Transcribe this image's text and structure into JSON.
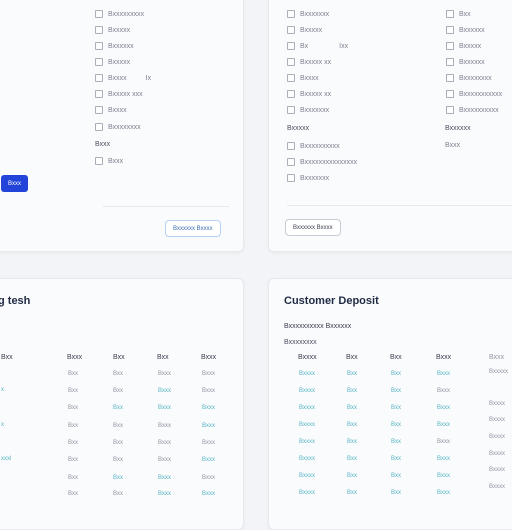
{
  "top_left": {
    "options": [
      "Bxxxxxxxxx",
      "Bxxxxx",
      "Bxxxxxx",
      "Bxxxxx",
      "Bxxxx",
      "Bxxxxx xxx",
      "Bxxxx",
      "Bxxxxxxxx"
    ],
    "option_suffixes": {
      "4": "Ix"
    },
    "section": "Bxxx",
    "section_options": [
      "Bxxx"
    ],
    "primary_button": "Bxxx",
    "outline_button": "Bxxxxxx Bxxxx"
  },
  "top_right": {
    "col1_options": [
      "Bxxxxxxx",
      "Bxxxxx",
      "Bx",
      "Bxxxxx xx",
      "Bxxxx",
      "Bxxxxx xx",
      "Bxxxxxxx"
    ],
    "col1_suffixes": {
      "2": "Ixx"
    },
    "col2_options": [
      "Bxx",
      "Bxxxxxx",
      "Bxxxxx",
      "Bxxxxxx",
      "Bxxxxxxxx",
      "Bxxxxxxxxxxx",
      "Bxxxxxxxxxx"
    ],
    "col1_section": "Bxxxxx",
    "col2_section": "Bxxxxxx",
    "col1_section_options": [
      "Bxxxxxxxxxx",
      "Bxxxxxxxxxxxxxxx",
      "Bxxxxxxx"
    ],
    "col2_section_value": "Bxxx",
    "outline_button": "Bxxxxxx Bxxxx"
  },
  "bottom_left": {
    "title": "g tesh",
    "headers": [
      "Bxx",
      "Bxxx",
      "Bxx",
      "Bxx",
      "Bxxx"
    ],
    "row_labels": [
      "",
      "x",
      "",
      "x",
      "",
      "xxxl",
      "",
      ""
    ],
    "rows": [
      [
        "Bxx",
        "Bxx",
        "Bxxx",
        "Bxxx"
      ],
      [
        "Bxx",
        "Bxx",
        "Bxxx",
        "Bxxx"
      ],
      [
        "Bxx",
        "Bxx",
        "Bxxx",
        "Bxxx"
      ],
      [
        "Bxx",
        "Bxx",
        "Bxxx",
        "Bxxx"
      ],
      [
        "Bxx",
        "Bxx",
        "Bxxx",
        "Bxxx"
      ],
      [
        "Bxx",
        "Bxx",
        "Bxxx",
        "Bxxx"
      ],
      [
        "Bxx",
        "Bxx",
        "Bxxx",
        "Bxxx"
      ],
      [
        "Bxx",
        "Bxx",
        "Bxxx",
        "Bxxx"
      ]
    ]
  },
  "bottom_right": {
    "title": "Customer Deposit",
    "subtitle": "Bxxxxxxxxxx Bxxxxxx",
    "section": "Bxxxxxxxx",
    "headers": [
      "Bxxxx",
      "Bxx",
      "Bxx",
      "Bxxx"
    ],
    "side_header": "Bxxx",
    "side_values": [
      "Bxxxxx",
      "Bxxxx",
      "Bxxxx",
      "Bxxxx",
      "Bxxxx",
      "Bxxxx",
      "Bxxxx"
    ],
    "rows": [
      [
        "Bxxxx",
        "Bxx",
        "Bxx",
        "Bxxx"
      ],
      [
        "Bxxxx",
        "Bxx",
        "Bxx",
        "Bxxx"
      ],
      [
        "Bxxxx",
        "Bxx",
        "Bxx",
        "Bxxx"
      ],
      [
        "Bxxxx",
        "Bxx",
        "Bxx",
        "Bxxx"
      ],
      [
        "Bxxxx",
        "Bxx",
        "Bxx",
        "Bxxx"
      ],
      [
        "Bxxxx",
        "Bxx",
        "Bxx",
        "Bxxx"
      ],
      [
        "Bxxxx",
        "Bxx",
        "Bxx",
        "Bxxx"
      ],
      [
        "Bxxxx",
        "Bxx",
        "Bxx",
        "Bxxx"
      ]
    ]
  },
  "colors": {
    "accent": "#2344d8",
    "teal_text": "#56b4c6",
    "title_text": "#1f2a44"
  }
}
